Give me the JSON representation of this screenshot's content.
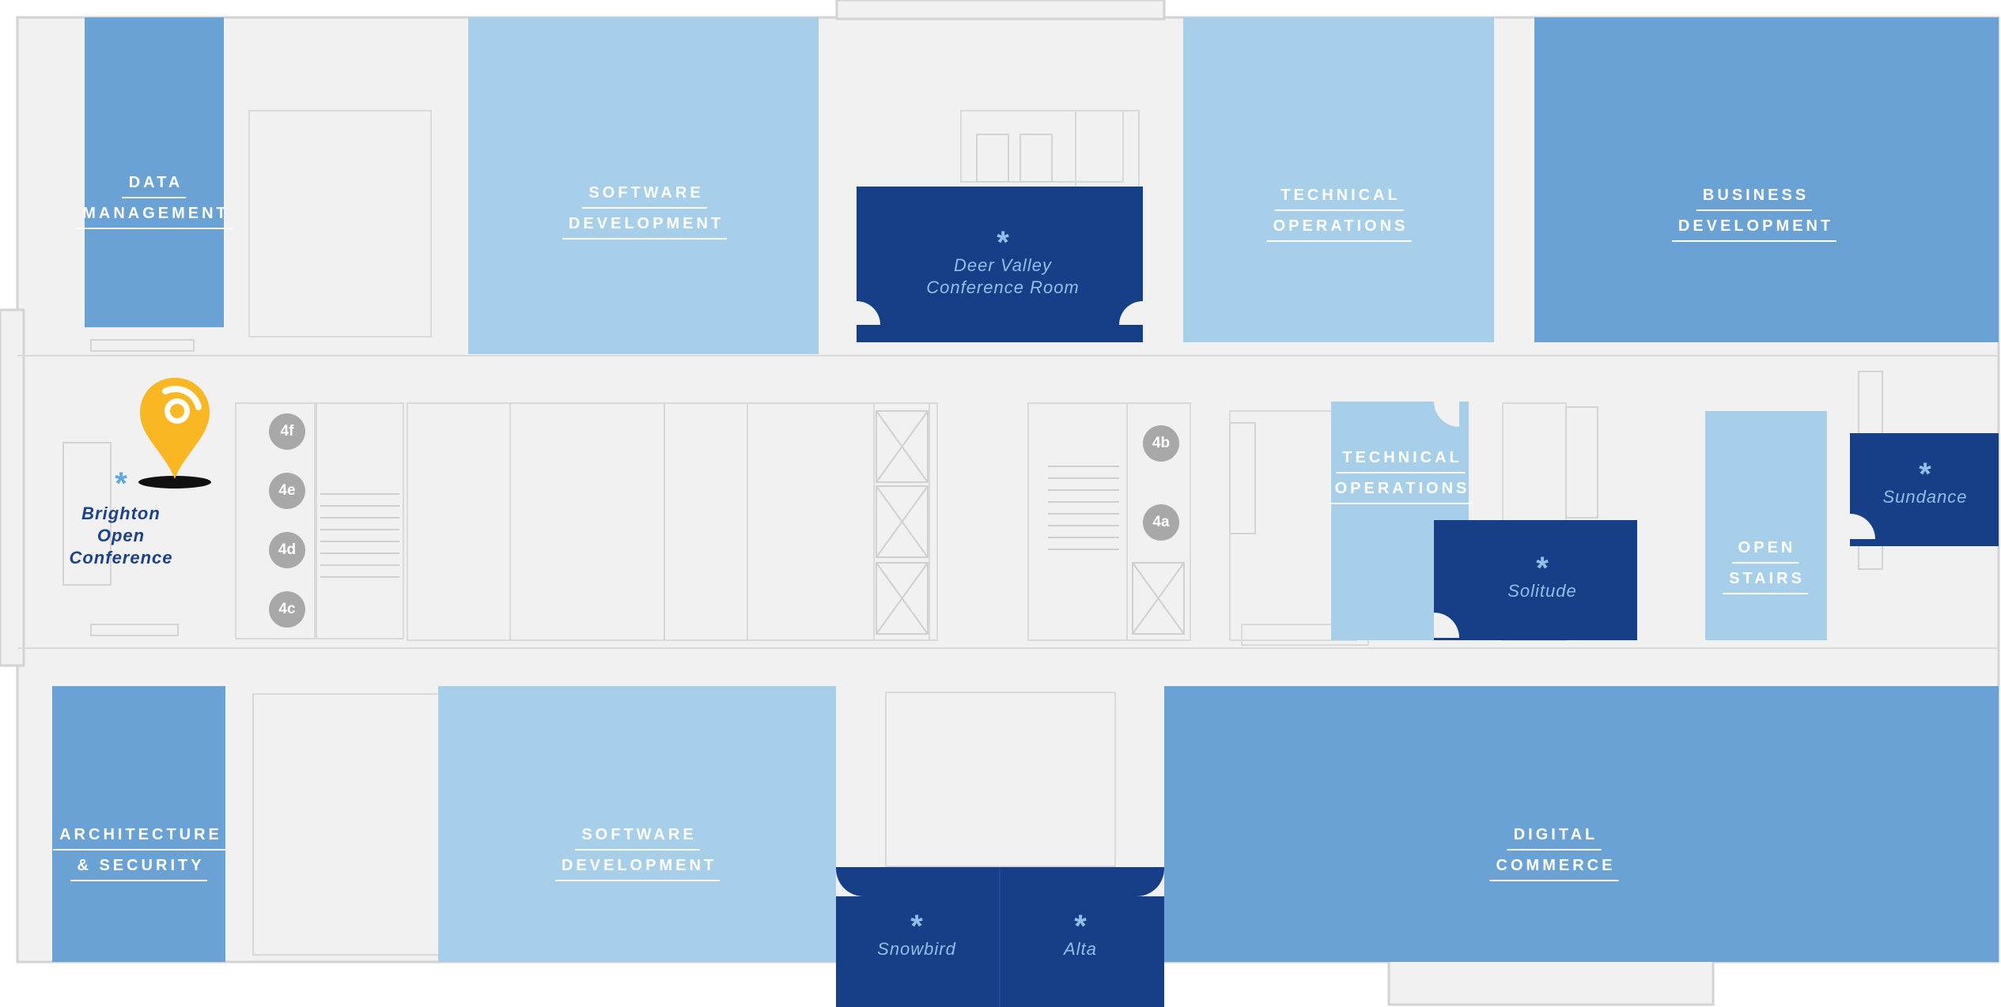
{
  "colors": {
    "floor": "#f1f1f1",
    "floor_line": "#d6d6d6",
    "light_blue": "#a7cfe9",
    "mid_blue": "#6aa2d5",
    "dark_blue": "#163f87",
    "conference_text": "#8ec0e8",
    "elevator_badge": "#a8a8a8",
    "pin": "#f9b823",
    "brighton_text": "#1d4289"
  },
  "departments": {
    "data_management": [
      "DATA",
      "MANAGEMENT"
    ],
    "software_development_top": [
      "SOFTWARE",
      "DEVELOPMENT"
    ],
    "technical_operations_top": [
      "TECHNICAL",
      "OPERATIONS"
    ],
    "business_development": [
      "BUSINESS",
      "DEVELOPMENT"
    ],
    "technical_operations_mid": [
      "TECHNICAL",
      "OPERATIONS"
    ],
    "open_stairs": [
      "OPEN",
      "STAIRS"
    ],
    "architecture_security": [
      "ARCHITECTURE",
      "& SECURITY"
    ],
    "software_development_bottom": [
      "SOFTWARE",
      "DEVELOPMENT"
    ],
    "digital_commerce": [
      "DIGITAL",
      "COMMERCE"
    ]
  },
  "conference_rooms": {
    "deer_valley": [
      "Deer Valley",
      "Conference Room"
    ],
    "solitude": [
      "Solitude"
    ],
    "sundance": [
      "Sundance"
    ],
    "snowbird": [
      "Snowbird"
    ],
    "alta": [
      "Alta"
    ],
    "brighton": [
      "Brighton",
      "Open",
      "Conference"
    ]
  },
  "conference_marker": "*",
  "elevators": [
    "4f",
    "4e",
    "4d",
    "4c",
    "4b",
    "4a"
  ],
  "location_pin": {
    "icon": "location-pin-icon"
  }
}
